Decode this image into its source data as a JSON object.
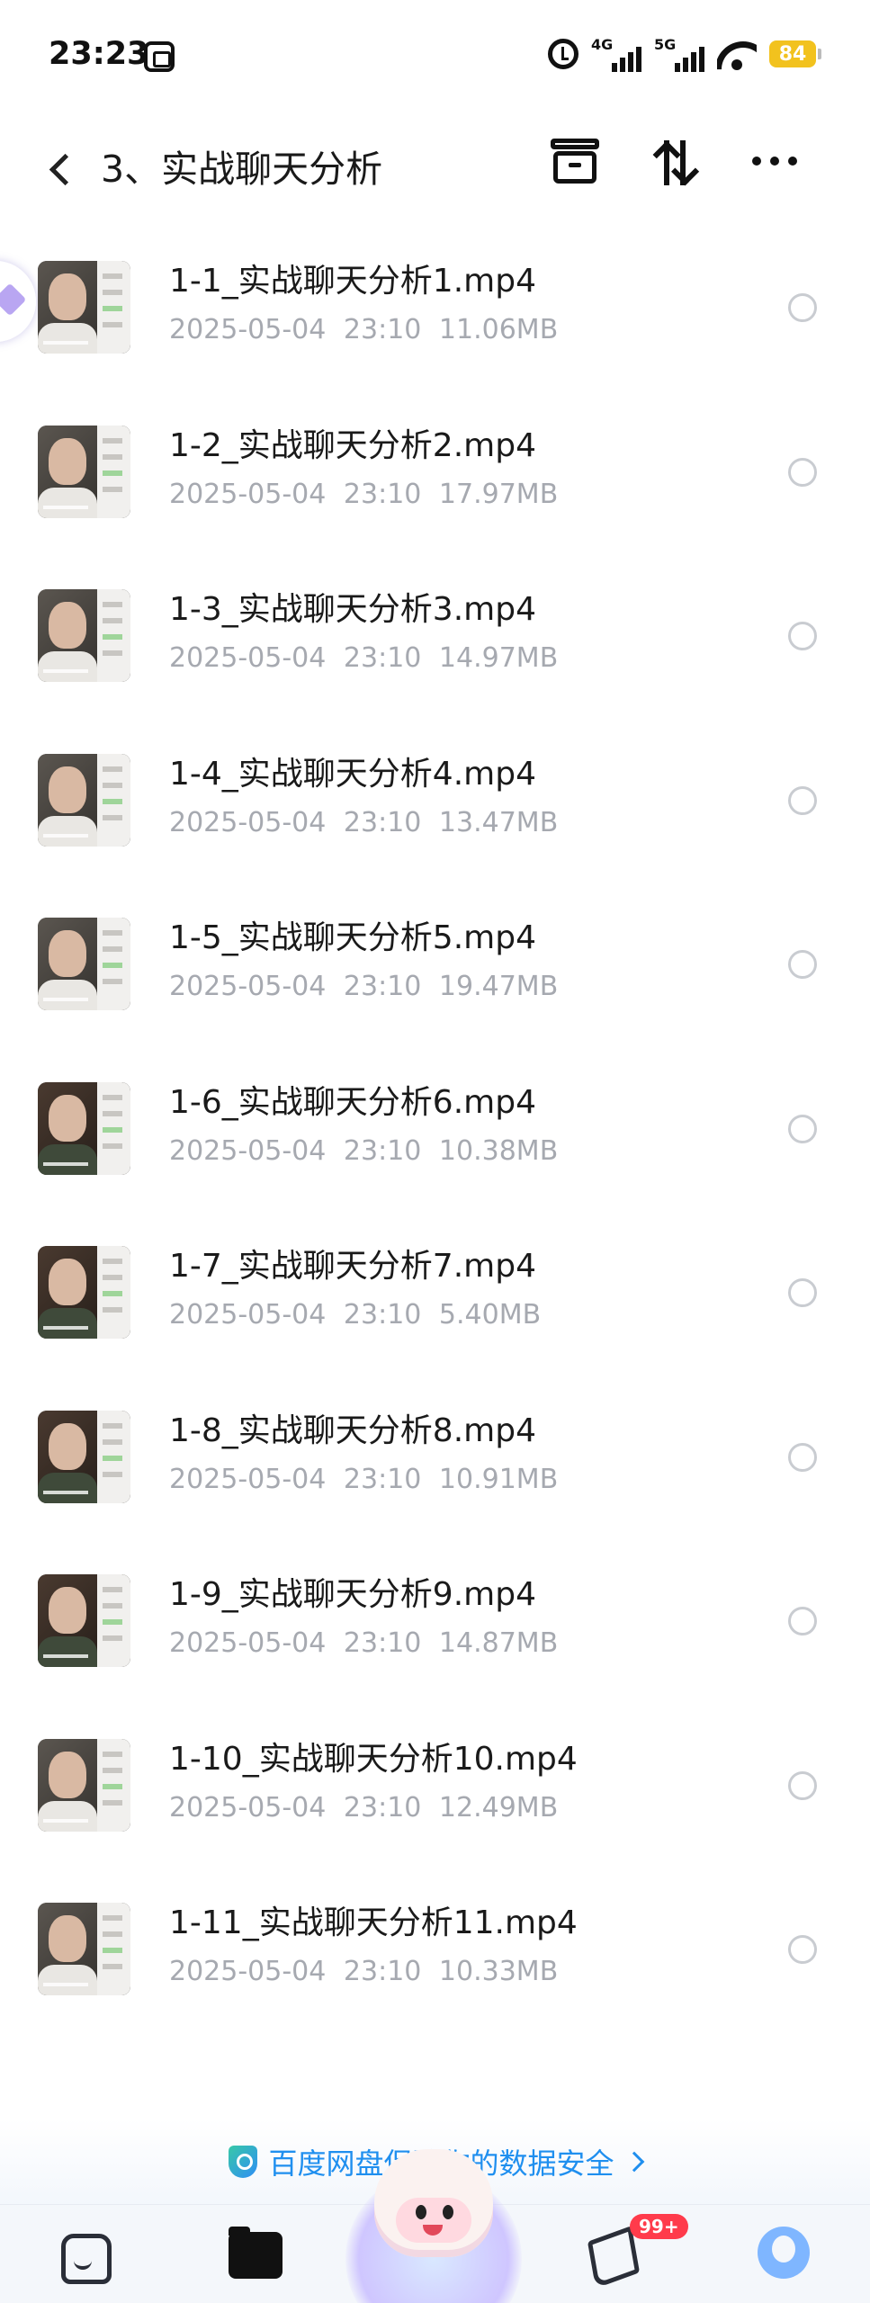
{
  "status_bar": {
    "time": "23:23",
    "network1": "4G",
    "network2": "5G",
    "battery": "84"
  },
  "header": {
    "title": "3、实战聊天分析"
  },
  "files": [
    {
      "name": "1-1_实战聊天分析1.mp4",
      "date": "2025-05-04",
      "time": "23:10",
      "size": "11.06MB"
    },
    {
      "name": "1-2_实战聊天分析2.mp4",
      "date": "2025-05-04",
      "time": "23:10",
      "size": "17.97MB"
    },
    {
      "name": "1-3_实战聊天分析3.mp4",
      "date": "2025-05-04",
      "time": "23:10",
      "size": "14.97MB"
    },
    {
      "name": "1-4_实战聊天分析4.mp4",
      "date": "2025-05-04",
      "time": "23:10",
      "size": "13.47MB"
    },
    {
      "name": "1-5_实战聊天分析5.mp4",
      "date": "2025-05-04",
      "time": "23:10",
      "size": "19.47MB"
    },
    {
      "name": "1-6_实战聊天分析6.mp4",
      "date": "2025-05-04",
      "time": "23:10",
      "size": "10.38MB"
    },
    {
      "name": "1-7_实战聊天分析7.mp4",
      "date": "2025-05-04",
      "time": "23:10",
      "size": "5.40MB"
    },
    {
      "name": "1-8_实战聊天分析8.mp4",
      "date": "2025-05-04",
      "time": "23:10",
      "size": "10.91MB"
    },
    {
      "name": "1-9_实战聊天分析9.mp4",
      "date": "2025-05-04",
      "time": "23:10",
      "size": "14.87MB"
    },
    {
      "name": "1-10_实战聊天分析10.mp4",
      "date": "2025-05-04",
      "time": "23:10",
      "size": "12.49MB"
    },
    {
      "name": "1-11_实战聊天分析11.mp4",
      "date": "2025-05-04",
      "time": "23:10",
      "size": "10.33MB"
    }
  ],
  "footer": {
    "safety_text": "百度网盘保障你的数据安全"
  },
  "bottom_nav": {
    "share_badge": "99+"
  },
  "colors": {
    "accent": "#1f8fef",
    "battery": "#f2c21e",
    "badge": "#ff3b4b",
    "meta_text": "#a6a9b0"
  }
}
